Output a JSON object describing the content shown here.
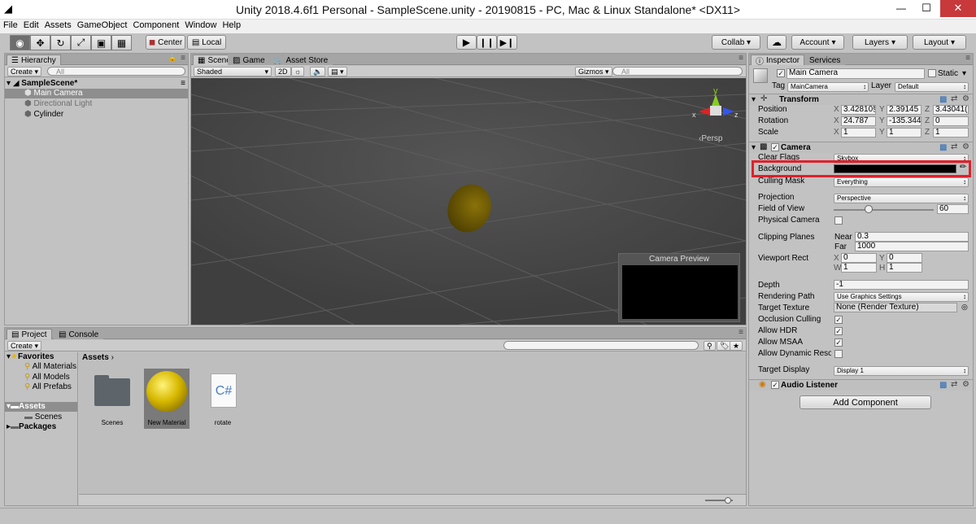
{
  "window": {
    "title": "Unity 2018.4.6f1 Personal - SampleScene.unity - 20190815 - PC, Mac & Linux Standalone* <DX11>",
    "minimize": "—",
    "maximize": "☐",
    "close": "✕"
  },
  "menu": [
    "File",
    "Edit",
    "Assets",
    "GameObject",
    "Component",
    "Window",
    "Help"
  ],
  "toolbar": {
    "center": "Center",
    "local": "Local",
    "collab": "Collab ▾",
    "account": "Account",
    "layers": "Layers",
    "layout": "Layout"
  },
  "hierarchy": {
    "tab": "Hierarchy",
    "create": "Create ▾",
    "search_placeholder": "All",
    "scene": "SampleScene*",
    "items": [
      "Main Camera",
      "Directional Light",
      "Cylinder"
    ]
  },
  "scene": {
    "tabs": [
      "Scene",
      "Game",
      "Asset Store"
    ],
    "shading": "Shaded",
    "mode2d": "2D",
    "gizmos": "Gizmos ▾",
    "search_placeholder": "All",
    "persp": "Persp",
    "gizmo_axes": [
      "y",
      "x",
      "z"
    ],
    "camera_preview": "Camera Preview"
  },
  "project": {
    "tabs": [
      "Project",
      "Console"
    ],
    "create": "Create ▾",
    "favorites": "Favorites",
    "fav_items": [
      "All Materials",
      "All Models",
      "All Prefabs"
    ],
    "assets": "Assets",
    "assets_children": [
      "Scenes"
    ],
    "packages": "Packages",
    "breadcrumb": "Assets",
    "files": [
      "Scenes",
      "New Material",
      "rotate"
    ],
    "script_glyph": "C#"
  },
  "inspector": {
    "tabs": [
      "Inspector",
      "Services"
    ],
    "object_name": "Main Camera",
    "static": "Static",
    "tag_label": "Tag",
    "tag": "MainCamera",
    "layer_label": "Layer",
    "layer": "Default",
    "transform": {
      "title": "Transform",
      "position_label": "Position",
      "position": [
        "3.42810§",
        "2.39145",
        "3.43041("
      ],
      "rotation_label": "Rotation",
      "rotation": [
        "24.787",
        "-135.344",
        "0"
      ],
      "scale_label": "Scale",
      "scale": [
        "1",
        "1",
        "1"
      ],
      "axes": [
        "X",
        "Y",
        "Z"
      ]
    },
    "camera": {
      "title": "Camera",
      "clear_flags_label": "Clear Flags",
      "clear_flags": "Skybox",
      "background_label": "Background",
      "background_color": "#000000",
      "culling_mask_label": "Culling Mask",
      "culling_mask": "Everything",
      "projection_label": "Projection",
      "projection": "Perspective",
      "fov_label": "Field of View",
      "fov": "60",
      "fov_fraction": 0.25,
      "physical_label": "Physical Camera",
      "clipping_label": "Clipping Planes",
      "near_label": "Near",
      "near": "0.3",
      "far_label": "Far",
      "far": "1000",
      "viewport_label": "Viewport Rect",
      "vp_x": "0",
      "vp_y": "0",
      "vp_w": "1",
      "vp_h": "1",
      "depth_label": "Depth",
      "depth": "-1",
      "rendering_path_label": "Rendering Path",
      "rendering_path": "Use Graphics Settings",
      "target_texture_label": "Target Texture",
      "target_texture": "None (Render Texture)",
      "occlusion_label": "Occlusion Culling",
      "hdr_label": "Allow HDR",
      "msaa_label": "Allow MSAA",
      "dynres_label": "Allow Dynamic Resolu",
      "target_display_label": "Target Display",
      "target_display": "Display 1"
    },
    "audio": {
      "title": "Audio Listener"
    },
    "add_component": "Add Component"
  },
  "colors": {
    "highlight": "#e0202a",
    "selection": "#8e8e8e",
    "scene_bg": "#474747"
  }
}
